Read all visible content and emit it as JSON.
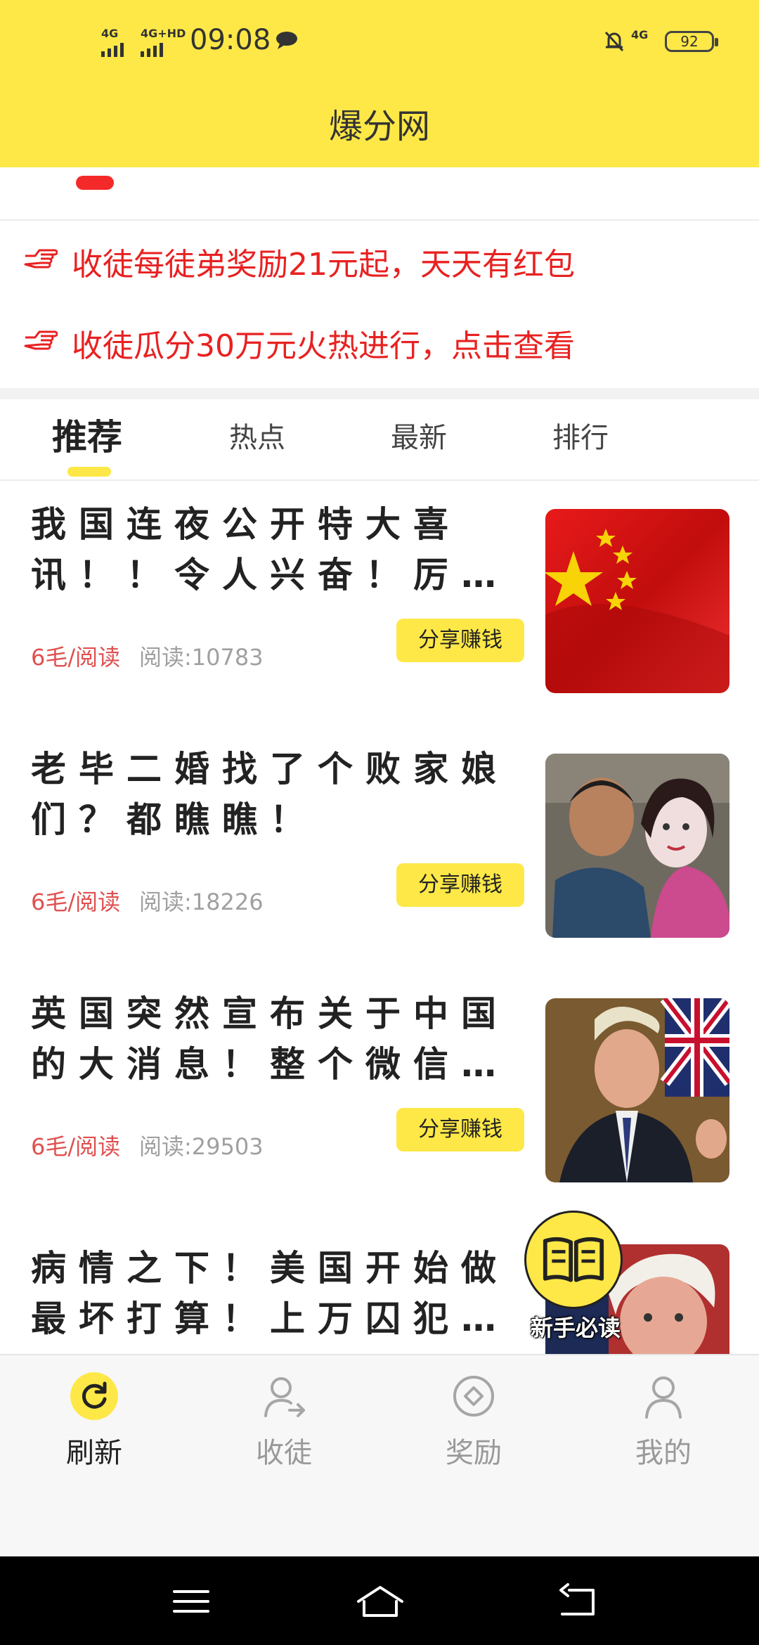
{
  "status_bar": {
    "signal1": "4G",
    "signal2": "4G+HD",
    "time": "09:08",
    "net": "4G",
    "battery": "92"
  },
  "app": {
    "title": "爆分网"
  },
  "promos": [
    {
      "text": "收徒每徒弟奖励21元起，天天有红包"
    },
    {
      "text": "收徒瓜分30万元火热进行，点击查看"
    }
  ],
  "tabs": [
    {
      "label": "推荐",
      "active": true
    },
    {
      "label": "热点",
      "active": false
    },
    {
      "label": "最新",
      "active": false
    },
    {
      "label": "排行",
      "active": false
    }
  ],
  "articles": [
    {
      "title": "我国连夜公开特大喜讯！！令人兴奋！厉…",
      "rate": "6毛/阅读",
      "reads": "阅读:10783",
      "share_label": "分享赚钱",
      "thumb": "china-flag"
    },
    {
      "title": "老毕二婚找了个败家娘们？都瞧瞧！",
      "rate": "6毛/阅读",
      "reads": "阅读:18226",
      "share_label": "分享赚钱",
      "thumb": "couple-photo"
    },
    {
      "title": "英国突然宣布关于中国的大消息！整个微信…",
      "rate": "6毛/阅读",
      "reads": "阅读:29503",
      "share_label": "分享赚钱",
      "thumb": "politician-photo"
    },
    {
      "title": "病情之下！美国开始做最坏打算！上万囚犯…",
      "rate": "",
      "reads": "",
      "share_label": "",
      "thumb": "man-photo"
    }
  ],
  "guide": {
    "label": "新手必读",
    "icon": "book-icon"
  },
  "bottom_nav": [
    {
      "label": "刷新",
      "icon": "refresh-icon",
      "active": true
    },
    {
      "label": "收徒",
      "icon": "add-user-icon",
      "active": false
    },
    {
      "label": "奖励",
      "icon": "reward-icon",
      "active": false
    },
    {
      "label": "我的",
      "icon": "profile-icon",
      "active": false
    }
  ],
  "colors": {
    "brand_yellow": "#fde847",
    "promo_red": "#e82121",
    "rate_red": "#e05050"
  }
}
